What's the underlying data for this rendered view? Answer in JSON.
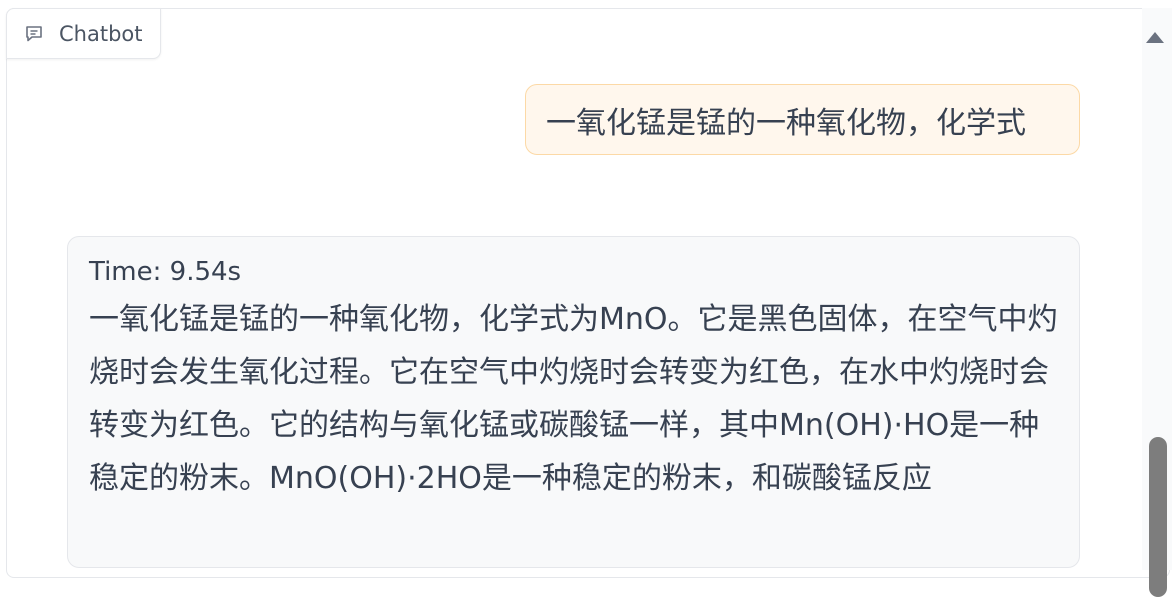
{
  "chatbot": {
    "label": "Chatbot",
    "icon": "chat-icon"
  },
  "messages": [
    {
      "role": "user",
      "text": "一氧化锰是锰的一种氧化物，化学式"
    },
    {
      "role": "bot",
      "time": "Time: 9.54s",
      "text": "一氧化锰是锰的一种氧化物，化学式为MnO。它是黑色固体，在空气中灼烧时会发生氧化过程。它在空气中灼烧时会转变为红色，在水中灼烧时会转变为红色。它的结构与氧化锰或碳酸锰一样，其中Mn(OH)·HO是一种稳定的粉末。MnO(OH)·2HO是一种稳定的粉末，和碳酸锰反应"
    }
  ],
  "colors": {
    "user_bubble_bg": "#fff7ed",
    "user_bubble_border": "#fcd9a6",
    "bot_bubble_bg": "#f8f9fa",
    "text": "#374151"
  }
}
